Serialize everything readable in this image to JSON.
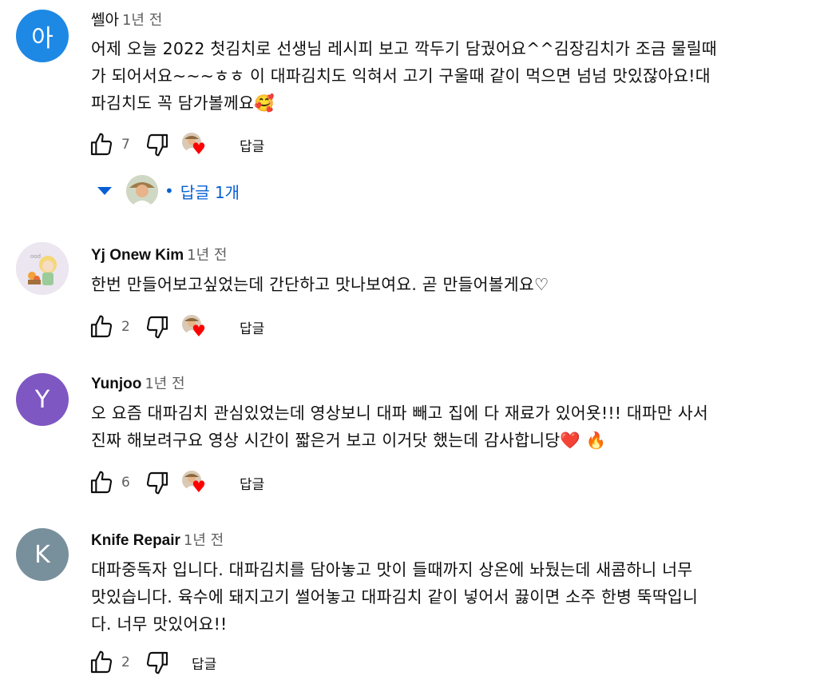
{
  "comments": [
    {
      "author": "쎌아",
      "avatar_text": "아",
      "avatar_color": "#1e88e5",
      "time": "1년 전",
      "text": "어제 오늘 2022 첫김치로 선생님 레시피 보고 깍두기 담궜어요^^김장김치가 조금 물릴때\n가 되어서요~~~ㅎㅎ 이 대파김치도 익혀서 고기 구울때 같이 먹으면 넘넘 맛있잖아요!대\n파김치도 꼭 담가볼께요🥰",
      "likes": "7",
      "reply_label": "답글",
      "replies_label": "답글 1개"
    },
    {
      "author": "Yj Onew Kim",
      "time": "1년 전",
      "text": "한번 만들어보고싶었는데 간단하고 맛나보여요. 곧 만들어볼게요♡",
      "likes": "2",
      "reply_label": "답글"
    },
    {
      "author": "Yunjoo",
      "avatar_text": "Y",
      "avatar_color": "#7e57c2",
      "time": "1년 전",
      "text": "오 요즘 대파김치 관심있었는데 영상보니 대파 빼고 집에 다 재료가 있어욧!!! 대파만 사서\n진짜 해보려구요 영상 시간이 짧은거 보고 이거닷 했는데 감사합니당❤️ 🔥",
      "likes": "6",
      "reply_label": "답글"
    },
    {
      "author": "Knife Repair",
      "avatar_text": "K",
      "avatar_color": "#78909c",
      "time": "1년 전",
      "text": "대파중독자 입니다. 대파김치를 담아놓고 맛이 들때까지 상온에 놔뒀는데 새콤하니 너무\n맛있습니다. 육수에 돼지고기 썰어놓고 대파김치 같이 넣어서 끓이면 소주 한병 뚝딱입니\n다. 너무 맛있어요!!",
      "likes": "2",
      "reply_label": "답글"
    }
  ],
  "colors": {
    "link": "#065fd4",
    "heart": "#ff0000",
    "meta": "#606060"
  },
  "icons": [
    "thumb-up-icon",
    "thumb-down-icon",
    "heart-icon",
    "caret-down-icon"
  ]
}
